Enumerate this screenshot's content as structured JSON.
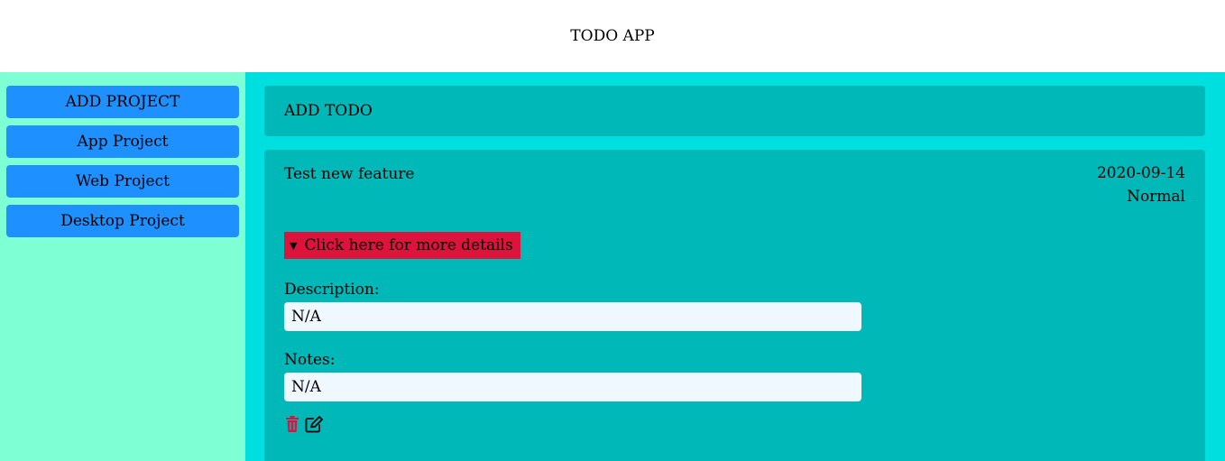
{
  "header": {
    "title": "TODO APP"
  },
  "sidebar": {
    "add_label": "ADD PROJECT",
    "projects": [
      {
        "label": "App Project"
      },
      {
        "label": "Web Project"
      },
      {
        "label": "Desktop Project"
      }
    ]
  },
  "main": {
    "add_todo_label": "ADD TODO",
    "todo": {
      "title": "Test new feature",
      "date": "2020-09-14",
      "priority": "Normal",
      "details_label": "Click here for more details",
      "description_label": "Description:",
      "description_value": "N/A",
      "notes_label": "Notes:",
      "notes_value": "N/A",
      "icons": {
        "delete": "trash-icon",
        "edit": "edit-icon"
      }
    }
  },
  "colors": {
    "sidebar_bg": "#7fffd4",
    "main_bg": "#00dfdf",
    "card_bg": "#00b8b8",
    "button_bg": "#1e90ff",
    "details_bg": "#dc143c",
    "input_bg": "#f0f8ff",
    "delete_icon": "#dc143c"
  }
}
